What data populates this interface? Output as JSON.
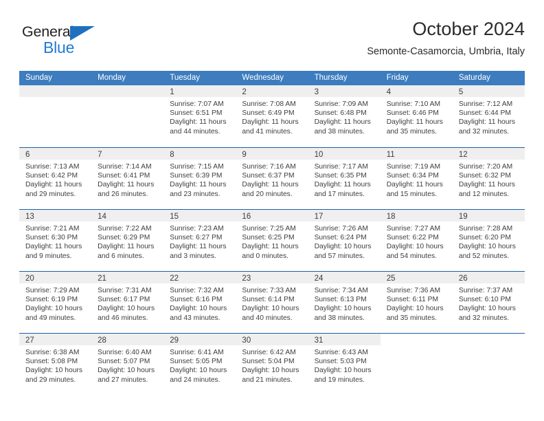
{
  "brand": {
    "name_part1": "General",
    "name_part2": "Blue",
    "color_dark": "#231f20",
    "color_blue": "#1f7ad4"
  },
  "header": {
    "title": "October 2024",
    "subtitle": "Semonte-Casamorcia, Umbria, Italy"
  },
  "calendar": {
    "header_bg": "#3c7cbf",
    "row_divider": "#1a5fa8",
    "daynum_band_bg": "#efefef",
    "weekdays": [
      "Sunday",
      "Monday",
      "Tuesday",
      "Wednesday",
      "Thursday",
      "Friday",
      "Saturday"
    ],
    "weeks": [
      [
        {
          "day": "",
          "empty": true,
          "sunrise": "",
          "sunset": "",
          "daylight_line1": "",
          "daylight_line2": ""
        },
        {
          "day": "",
          "empty": true,
          "sunrise": "",
          "sunset": "",
          "daylight_line1": "",
          "daylight_line2": ""
        },
        {
          "day": "1",
          "sunrise": "Sunrise: 7:07 AM",
          "sunset": "Sunset: 6:51 PM",
          "daylight_line1": "Daylight: 11 hours",
          "daylight_line2": "and 44 minutes."
        },
        {
          "day": "2",
          "sunrise": "Sunrise: 7:08 AM",
          "sunset": "Sunset: 6:49 PM",
          "daylight_line1": "Daylight: 11 hours",
          "daylight_line2": "and 41 minutes."
        },
        {
          "day": "3",
          "sunrise": "Sunrise: 7:09 AM",
          "sunset": "Sunset: 6:48 PM",
          "daylight_line1": "Daylight: 11 hours",
          "daylight_line2": "and 38 minutes."
        },
        {
          "day": "4",
          "sunrise": "Sunrise: 7:10 AM",
          "sunset": "Sunset: 6:46 PM",
          "daylight_line1": "Daylight: 11 hours",
          "daylight_line2": "and 35 minutes."
        },
        {
          "day": "5",
          "sunrise": "Sunrise: 7:12 AM",
          "sunset": "Sunset: 6:44 PM",
          "daylight_line1": "Daylight: 11 hours",
          "daylight_line2": "and 32 minutes."
        }
      ],
      [
        {
          "day": "6",
          "sunrise": "Sunrise: 7:13 AM",
          "sunset": "Sunset: 6:42 PM",
          "daylight_line1": "Daylight: 11 hours",
          "daylight_line2": "and 29 minutes."
        },
        {
          "day": "7",
          "sunrise": "Sunrise: 7:14 AM",
          "sunset": "Sunset: 6:41 PM",
          "daylight_line1": "Daylight: 11 hours",
          "daylight_line2": "and 26 minutes."
        },
        {
          "day": "8",
          "sunrise": "Sunrise: 7:15 AM",
          "sunset": "Sunset: 6:39 PM",
          "daylight_line1": "Daylight: 11 hours",
          "daylight_line2": "and 23 minutes."
        },
        {
          "day": "9",
          "sunrise": "Sunrise: 7:16 AM",
          "sunset": "Sunset: 6:37 PM",
          "daylight_line1": "Daylight: 11 hours",
          "daylight_line2": "and 20 minutes."
        },
        {
          "day": "10",
          "sunrise": "Sunrise: 7:17 AM",
          "sunset": "Sunset: 6:35 PM",
          "daylight_line1": "Daylight: 11 hours",
          "daylight_line2": "and 17 minutes."
        },
        {
          "day": "11",
          "sunrise": "Sunrise: 7:19 AM",
          "sunset": "Sunset: 6:34 PM",
          "daylight_line1": "Daylight: 11 hours",
          "daylight_line2": "and 15 minutes."
        },
        {
          "day": "12",
          "sunrise": "Sunrise: 7:20 AM",
          "sunset": "Sunset: 6:32 PM",
          "daylight_line1": "Daylight: 11 hours",
          "daylight_line2": "and 12 minutes."
        }
      ],
      [
        {
          "day": "13",
          "sunrise": "Sunrise: 7:21 AM",
          "sunset": "Sunset: 6:30 PM",
          "daylight_line1": "Daylight: 11 hours",
          "daylight_line2": "and 9 minutes."
        },
        {
          "day": "14",
          "sunrise": "Sunrise: 7:22 AM",
          "sunset": "Sunset: 6:29 PM",
          "daylight_line1": "Daylight: 11 hours",
          "daylight_line2": "and 6 minutes."
        },
        {
          "day": "15",
          "sunrise": "Sunrise: 7:23 AM",
          "sunset": "Sunset: 6:27 PM",
          "daylight_line1": "Daylight: 11 hours",
          "daylight_line2": "and 3 minutes."
        },
        {
          "day": "16",
          "sunrise": "Sunrise: 7:25 AM",
          "sunset": "Sunset: 6:25 PM",
          "daylight_line1": "Daylight: 11 hours",
          "daylight_line2": "and 0 minutes."
        },
        {
          "day": "17",
          "sunrise": "Sunrise: 7:26 AM",
          "sunset": "Sunset: 6:24 PM",
          "daylight_line1": "Daylight: 10 hours",
          "daylight_line2": "and 57 minutes."
        },
        {
          "day": "18",
          "sunrise": "Sunrise: 7:27 AM",
          "sunset": "Sunset: 6:22 PM",
          "daylight_line1": "Daylight: 10 hours",
          "daylight_line2": "and 54 minutes."
        },
        {
          "day": "19",
          "sunrise": "Sunrise: 7:28 AM",
          "sunset": "Sunset: 6:20 PM",
          "daylight_line1": "Daylight: 10 hours",
          "daylight_line2": "and 52 minutes."
        }
      ],
      [
        {
          "day": "20",
          "sunrise": "Sunrise: 7:29 AM",
          "sunset": "Sunset: 6:19 PM",
          "daylight_line1": "Daylight: 10 hours",
          "daylight_line2": "and 49 minutes."
        },
        {
          "day": "21",
          "sunrise": "Sunrise: 7:31 AM",
          "sunset": "Sunset: 6:17 PM",
          "daylight_line1": "Daylight: 10 hours",
          "daylight_line2": "and 46 minutes."
        },
        {
          "day": "22",
          "sunrise": "Sunrise: 7:32 AM",
          "sunset": "Sunset: 6:16 PM",
          "daylight_line1": "Daylight: 10 hours",
          "daylight_line2": "and 43 minutes."
        },
        {
          "day": "23",
          "sunrise": "Sunrise: 7:33 AM",
          "sunset": "Sunset: 6:14 PM",
          "daylight_line1": "Daylight: 10 hours",
          "daylight_line2": "and 40 minutes."
        },
        {
          "day": "24",
          "sunrise": "Sunrise: 7:34 AM",
          "sunset": "Sunset: 6:13 PM",
          "daylight_line1": "Daylight: 10 hours",
          "daylight_line2": "and 38 minutes."
        },
        {
          "day": "25",
          "sunrise": "Sunrise: 7:36 AM",
          "sunset": "Sunset: 6:11 PM",
          "daylight_line1": "Daylight: 10 hours",
          "daylight_line2": "and 35 minutes."
        },
        {
          "day": "26",
          "sunrise": "Sunrise: 7:37 AM",
          "sunset": "Sunset: 6:10 PM",
          "daylight_line1": "Daylight: 10 hours",
          "daylight_line2": "and 32 minutes."
        }
      ],
      [
        {
          "day": "27",
          "sunrise": "Sunrise: 6:38 AM",
          "sunset": "Sunset: 5:08 PM",
          "daylight_line1": "Daylight: 10 hours",
          "daylight_line2": "and 29 minutes."
        },
        {
          "day": "28",
          "sunrise": "Sunrise: 6:40 AM",
          "sunset": "Sunset: 5:07 PM",
          "daylight_line1": "Daylight: 10 hours",
          "daylight_line2": "and 27 minutes."
        },
        {
          "day": "29",
          "sunrise": "Sunrise: 6:41 AM",
          "sunset": "Sunset: 5:05 PM",
          "daylight_line1": "Daylight: 10 hours",
          "daylight_line2": "and 24 minutes."
        },
        {
          "day": "30",
          "sunrise": "Sunrise: 6:42 AM",
          "sunset": "Sunset: 5:04 PM",
          "daylight_line1": "Daylight: 10 hours",
          "daylight_line2": "and 21 minutes."
        },
        {
          "day": "31",
          "sunrise": "Sunrise: 6:43 AM",
          "sunset": "Sunset: 5:03 PM",
          "daylight_line1": "Daylight: 10 hours",
          "daylight_line2": "and 19 minutes."
        },
        {
          "day": "",
          "blank": true,
          "sunrise": "",
          "sunset": "",
          "daylight_line1": "",
          "daylight_line2": ""
        },
        {
          "day": "",
          "blank": true,
          "sunrise": "",
          "sunset": "",
          "daylight_line1": "",
          "daylight_line2": ""
        }
      ]
    ]
  }
}
